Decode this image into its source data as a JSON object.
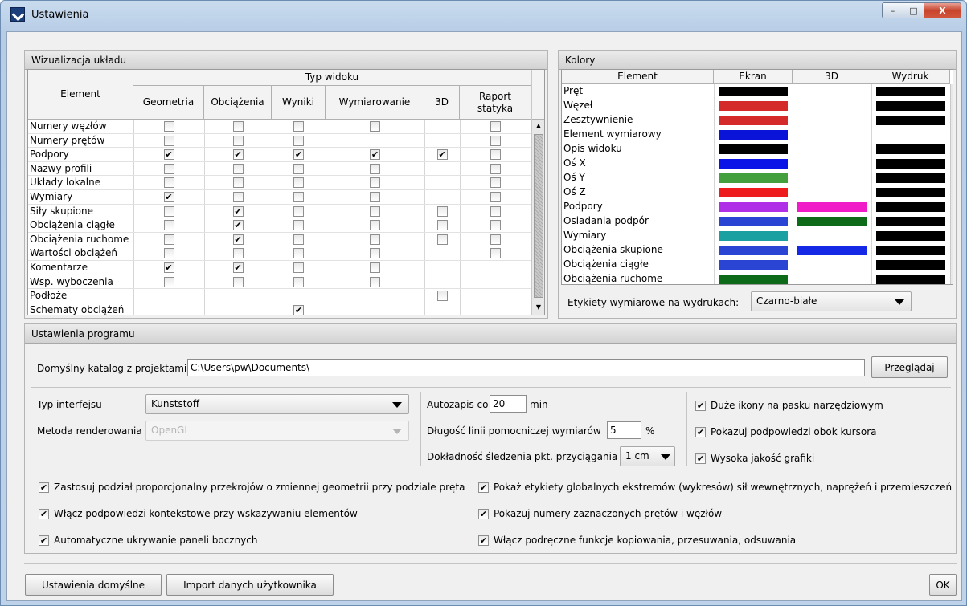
{
  "window": {
    "title": "Ustawienia",
    "min": "–",
    "max": "□",
    "close": "X"
  },
  "viz": {
    "header": "Wizualizacja układu",
    "element_col": "Element",
    "typ_widoku": "Typ widoku",
    "columns": [
      "Geometria",
      "Obciążenia",
      "Wyniki",
      "Wymiarowanie",
      "3D",
      "Raport statyka"
    ],
    "rows": [
      {
        "label": "Numery węzłów",
        "cells": [
          0,
          0,
          0,
          0,
          -1,
          0
        ]
      },
      {
        "label": "Numery prętów",
        "cells": [
          0,
          0,
          0,
          -1,
          -1,
          0
        ]
      },
      {
        "label": "Podpory",
        "cells": [
          1,
          1,
          1,
          1,
          1,
          0
        ]
      },
      {
        "label": "Nazwy profili",
        "cells": [
          0,
          0,
          0,
          0,
          -1,
          0
        ]
      },
      {
        "label": "Układy lokalne",
        "cells": [
          0,
          0,
          0,
          0,
          -1,
          0
        ]
      },
      {
        "label": "Wymiary",
        "cells": [
          1,
          0,
          0,
          0,
          -1,
          0
        ]
      },
      {
        "label": "Siły skupione",
        "cells": [
          0,
          1,
          0,
          0,
          0,
          0
        ]
      },
      {
        "label": "Obciążenia ciągłe",
        "cells": [
          0,
          1,
          0,
          0,
          0,
          0
        ]
      },
      {
        "label": "Obciążenia ruchome",
        "cells": [
          0,
          1,
          0,
          0,
          0,
          0
        ]
      },
      {
        "label": "Wartości obciążeń",
        "cells": [
          0,
          0,
          0,
          0,
          -1,
          0
        ]
      },
      {
        "label": "Komentarze",
        "cells": [
          1,
          1,
          0,
          0,
          -1,
          -1
        ]
      },
      {
        "label": "Wsp. wyboczenia",
        "cells": [
          0,
          0,
          0,
          0,
          -1,
          -1
        ]
      },
      {
        "label": "Podłoże",
        "cells": [
          -1,
          -1,
          -1,
          -1,
          0,
          -1
        ]
      },
      {
        "label": "Schematy obciążeń",
        "cells": [
          -1,
          -1,
          1,
          -1,
          -1,
          -1
        ]
      }
    ]
  },
  "colors": {
    "header": "Kolory",
    "columns": [
      "Element",
      "Ekran",
      "3D",
      "Wydruk"
    ],
    "rows": [
      {
        "label": "Pręt",
        "ekran": "#000000",
        "d3": "",
        "wydruk": "#000000"
      },
      {
        "label": "Węzeł",
        "ekran": "#d42a2a",
        "d3": "",
        "wydruk": "#000000"
      },
      {
        "label": "Zesztywnienie",
        "ekran": "#d42a2a",
        "d3": "",
        "wydruk": "#000000"
      },
      {
        "label": "Element wymiarowy",
        "ekran": "#0a14d8",
        "d3": "",
        "wydruk": ""
      },
      {
        "label": "Opis widoku",
        "ekran": "#000000",
        "d3": "",
        "wydruk": "#000000"
      },
      {
        "label": "Oś X",
        "ekran": "#0a14e6",
        "d3": "",
        "wydruk": "#000000"
      },
      {
        "label": "Oś Y",
        "ekran": "#44a03c",
        "d3": "",
        "wydruk": "#000000"
      },
      {
        "label": "Oś Z",
        "ekran": "#ee1c1c",
        "d3": "",
        "wydruk": "#000000"
      },
      {
        "label": "Podpory",
        "ekran": "#b030e8",
        "d3": "#f01cc8",
        "wydruk": "#000000"
      },
      {
        "label": "Osiadania podpór",
        "ekran": "#2a44d4",
        "d3": "#0c6a18",
        "wydruk": "#000000"
      },
      {
        "label": "Wymiary",
        "ekran": "#1aa0a0",
        "d3": "",
        "wydruk": "#000000"
      },
      {
        "label": "Obciążenia skupione",
        "ekran": "#2a44d4",
        "d3": "#1428e6",
        "wydruk": "#000000"
      },
      {
        "label": "Obciążenia ciągłe",
        "ekran": "#2a44d4",
        "d3": "",
        "wydruk": "#000000"
      },
      {
        "label": "Obciążenia ruchome",
        "ekran": "#0c6a18",
        "d3": "",
        "wydruk": "#000000"
      }
    ],
    "print_labels_label": "Etykiety wymiarowe na wydrukach:",
    "print_labels_value": "Czarno-białe"
  },
  "program": {
    "header": "Ustawienia programu",
    "dir_label": "Domyślny katalog z projektami",
    "dir_value": "C:\\Users\\pw\\Documents\\",
    "browse": "Przeglądaj",
    "iface_label": "Typ interfejsu",
    "iface_value": "Kunststoff",
    "render_label": "Metoda renderowania",
    "render_value": "OpenGL",
    "autosave_label": "Autozapis co",
    "autosave_value": "20",
    "autosave_unit": "min",
    "dimline_label": "Długość linii pomocniczej wymiarów",
    "dimline_value": "5",
    "dimline_unit": "%",
    "snap_label": "Dokładność śledzenia pkt. przyciągania",
    "snap_value": "1 cm",
    "right_checks": [
      {
        "label": "Duże ikony na pasku narzędziowym",
        "checked": true
      },
      {
        "label": "Pokazuj podpowiedzi obok kursora",
        "checked": true
      },
      {
        "label": "Wysoka jakość grafiki",
        "checked": true
      }
    ],
    "left_checks": [
      {
        "label": "Zastosuj podział proporcjonalny przekrojów o zmiennej geometrii przy podziale pręta",
        "checked": true
      },
      {
        "label": "Włącz podpowiedzi kontekstowe przy wskazywaniu elementów",
        "checked": true
      },
      {
        "label": "Automatyczne ukrywanie paneli bocznych",
        "checked": true
      }
    ],
    "mid_checks": [
      {
        "label": "Pokaż etykiety globalnych ekstremów (wykresów) sił wewnętrznych, naprężeń i przemieszczeń",
        "checked": true
      },
      {
        "label": "Pokazuj numery zaznaczonych prętów i węzłów",
        "checked": true
      },
      {
        "label": "Włącz podręczne funkcje kopiowania, przesuwania, odsuwania",
        "checked": true
      }
    ]
  },
  "footer": {
    "defaults": "Ustawienia domyślne",
    "import": "Import danych użytkownika",
    "ok": "OK"
  },
  "check_glyph": "✔"
}
